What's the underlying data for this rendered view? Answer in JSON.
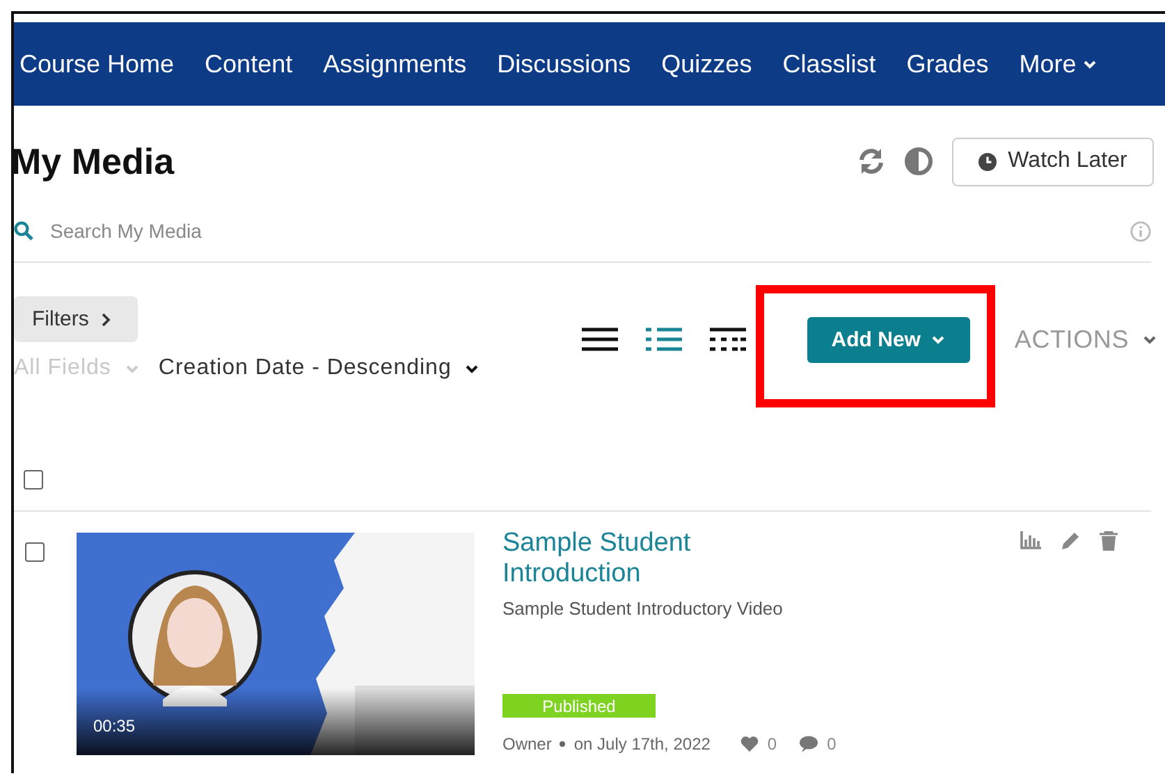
{
  "nav": {
    "items": [
      {
        "label": "Course Home"
      },
      {
        "label": "Content"
      },
      {
        "label": "Assignments"
      },
      {
        "label": "Discussions"
      },
      {
        "label": "Quizzes"
      },
      {
        "label": "Classlist"
      },
      {
        "label": "Grades"
      },
      {
        "label": "More",
        "dropdown": true
      }
    ]
  },
  "page": {
    "title": "My Media",
    "watch_later": "Watch Later"
  },
  "search": {
    "placeholder": "Search My Media"
  },
  "toolbar": {
    "filters": "Filters",
    "field_filter": {
      "label": "All Fields",
      "disabled": true
    },
    "sort": "Creation Date - Descending",
    "view_modes": [
      {
        "kind": "list",
        "selected": false
      },
      {
        "kind": "detailed",
        "selected": true
      },
      {
        "kind": "compact",
        "selected": false
      }
    ],
    "add_new": "Add New",
    "actions": "ACTIONS",
    "highlight": {
      "kind": "frame",
      "color": "#ff0000"
    }
  },
  "select_all": {
    "checked": false
  },
  "media": [
    {
      "checked": false,
      "duration": "00:35",
      "title": "Sample Student Introduction",
      "description": "Sample Student Introductory Video",
      "status": "Published",
      "role": "Owner",
      "date": "on July 17th, 2022",
      "likes": "0",
      "comments": "0"
    }
  ]
}
